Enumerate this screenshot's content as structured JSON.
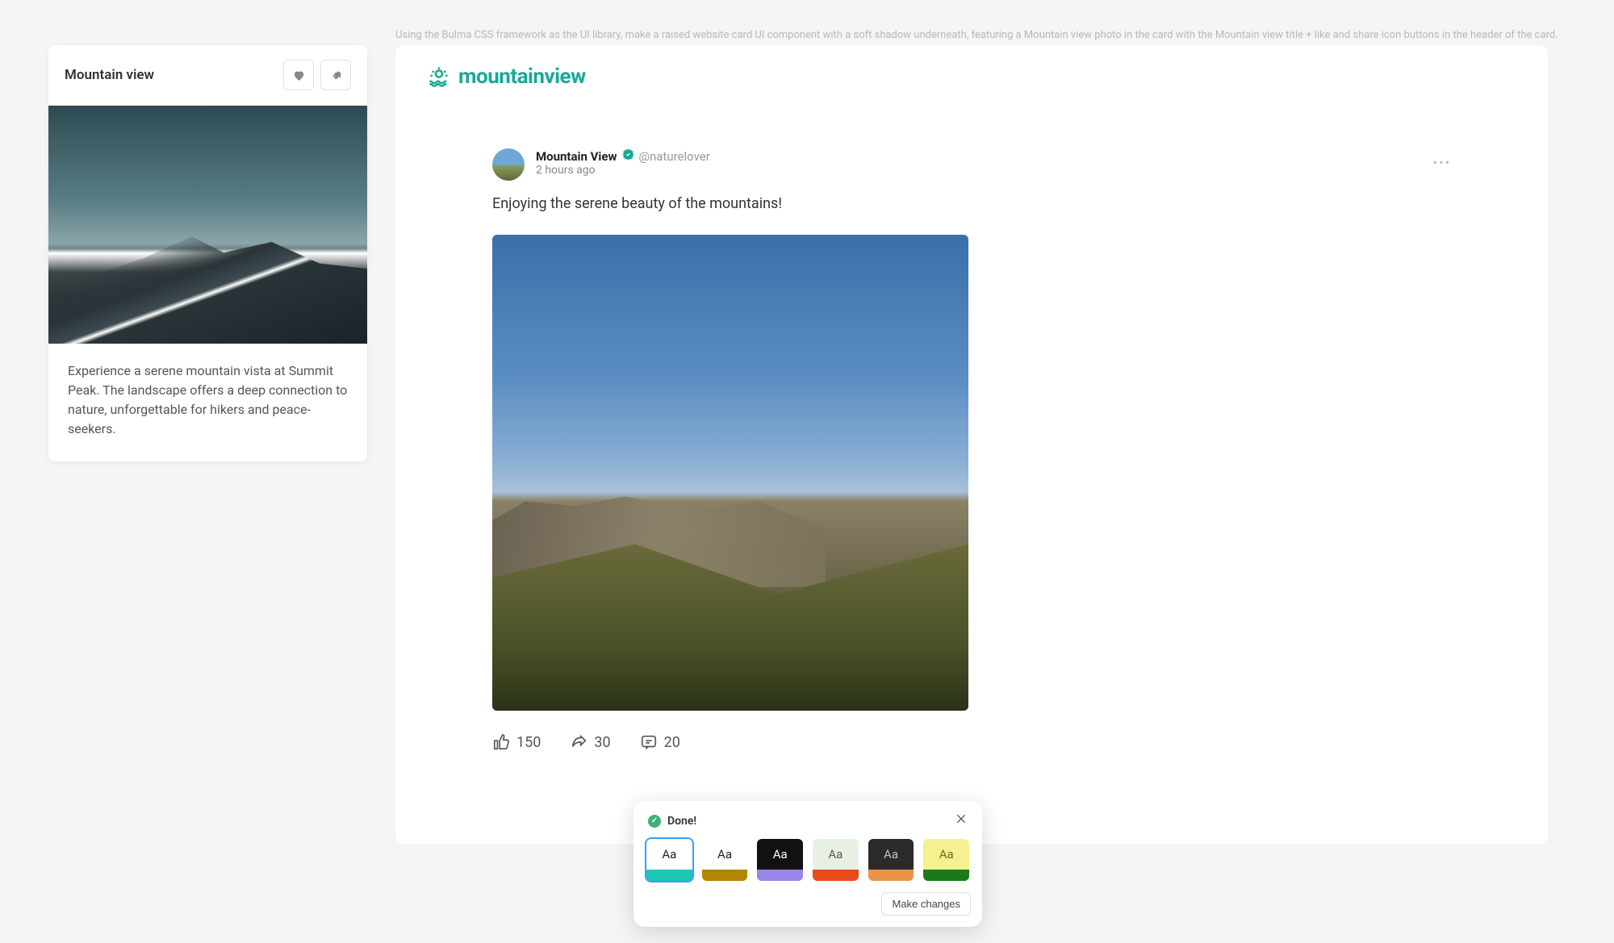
{
  "instruction": "Using the Bulma CSS framework as the UI library, make a raised website card UI component with a soft shadow underneath, featuring a Mountain view photo in the card with the Mountain view title + like and share icon buttons in the header of the card.",
  "left_card": {
    "title": "Mountain view",
    "description": "Experience a serene mountain vista at Summit Peak. The landscape offers a deep connection to nature, unforgettable for hikers and peace-seekers."
  },
  "brand": {
    "name": "mountainview"
  },
  "post": {
    "author": "Mountain View",
    "handle": "@naturelover",
    "time": "2 hours ago",
    "text": "Enjoying the serene beauty of the mountains!",
    "likes": "150",
    "shares": "30",
    "comments": "20"
  },
  "theme": {
    "status": "Done!",
    "make_changes": "Make changes",
    "swatch_label": "Aa",
    "swatches": [
      {
        "top_bg": "#ffffff",
        "top_fg": "#222222",
        "bottom": "#1cc7b6",
        "selected": true
      },
      {
        "top_bg": "#ffffff",
        "top_fg": "#222222",
        "bottom": "#b38600",
        "selected": false
      },
      {
        "top_bg": "#111111",
        "top_fg": "#ffffff",
        "bottom": "#9a86e8",
        "selected": false
      },
      {
        "top_bg": "#e8f0e6",
        "top_fg": "#5a5a5a",
        "bottom": "#e84a1c",
        "selected": false
      },
      {
        "top_bg": "#2a2a2a",
        "top_fg": "#c0c0c0",
        "bottom": "#e8954a",
        "selected": false
      },
      {
        "top_bg": "#f5f090",
        "top_fg": "#6a6a1a",
        "bottom": "#1a7a1a",
        "selected": false
      }
    ]
  }
}
